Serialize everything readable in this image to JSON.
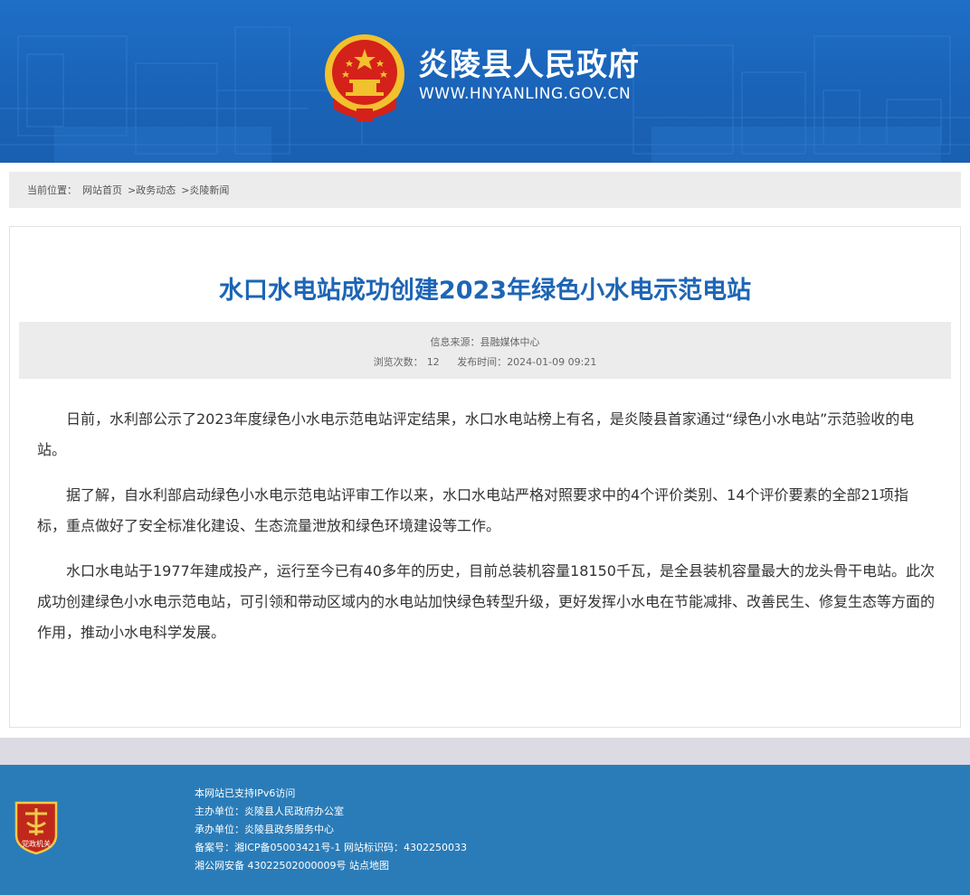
{
  "header": {
    "site_title": "炎陵县人民政府",
    "site_url": "WWW.HNYANLING.GOV.CN"
  },
  "breadcrumb": {
    "label": "当前位置：",
    "items": [
      "网站首页",
      ">政务动态",
      ">炎陵新闻"
    ]
  },
  "article": {
    "title": "水口水电站成功创建2023年绿色小水电示范电站",
    "source": "信息来源：县融媒体中心",
    "views_label": "浏览次数：",
    "views": "12",
    "publish_label": "发布时间：",
    "publish_time": "2024-01-09 09:21",
    "paragraphs": [
      "日前，水利部公示了2023年度绿色小水电示范电站评定结果，水口水电站榜上有名，是炎陵县首家通过“绿色小水电站”示范验收的电站。",
      "据了解，自水利部启动绿色小水电示范电站评审工作以来，水口水电站严格对照要求中的4个评价类别、14个评价要素的全部21项指标，重点做好了安全标准化建设、生态流量泄放和绿色环境建设等工作。",
      "水口水电站于1977年建成投产，运行至今已有40多年的历史，目前总装机容量18150千瓦，是全县装机容量最大的龙头骨干电站。此次成功创建绿色小水电示范电站，可引领和带动区域内的水电站加快绿色转型升级，更好发挥小水电在节能减排、改善民生、修复生态等方面的作用，推动小水电科学发展。"
    ]
  },
  "footer": {
    "badge_text": "党政机关",
    "lines": [
      "本网站已支持IPv6访问",
      "主办单位：炎陵县人民政府办公室",
      "承办单位：炎陵县政务服务中心",
      "备案号：湘ICP备05003421号-1 网站标识码：4302250033",
      "湘公网安备 43022502000009号 站点地图"
    ]
  },
  "colors": {
    "header_blue": "#1a63b8",
    "title_blue": "#1d65b5",
    "footer_blue": "#2a7cb8",
    "emblem_red": "#d4211a",
    "emblem_gold": "#f2c12e"
  },
  "icons": {
    "emblem": "national-emblem-icon",
    "badge": "party-government-badge-icon"
  }
}
